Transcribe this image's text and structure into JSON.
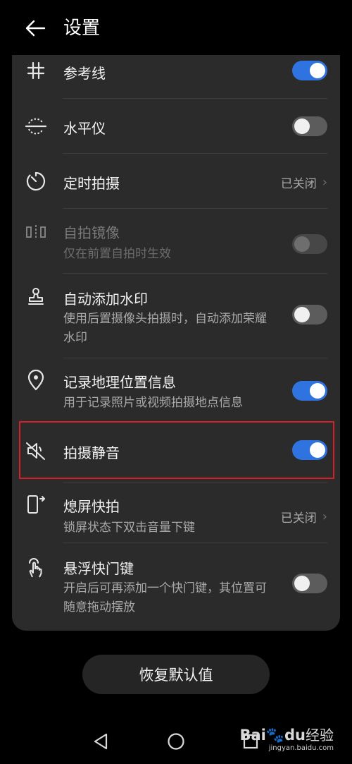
{
  "header": {
    "title": "设置",
    "back_icon": "arrow-left-icon"
  },
  "settings": {
    "grid": {
      "title": "参考线",
      "toggle": "on",
      "icon": "grid-icon"
    },
    "level": {
      "title": "水平仪",
      "toggle": "off",
      "icon": "level-icon"
    },
    "timer": {
      "title": "定时拍摄",
      "value": "已关闭",
      "icon": "timer-icon"
    },
    "mirror": {
      "title": "自拍镜像",
      "desc": "仅在前置自拍时生效",
      "toggle": "disabled-off",
      "icon": "mirror-icon"
    },
    "watermark": {
      "title": "自动添加水印",
      "desc": "使用后置摄像头拍摄时，自动添加荣耀水印",
      "toggle": "off",
      "icon": "stamp-icon"
    },
    "location": {
      "title": "记录地理位置信息",
      "desc": "用于记录照片或视频拍摄地点信息",
      "toggle": "on",
      "icon": "location-pin-icon"
    },
    "mute": {
      "title": "拍摄静音",
      "toggle": "on",
      "icon": "speaker-mute-icon",
      "highlighted": true
    },
    "screen_off": {
      "title": "熄屏快拍",
      "desc": "锁屏状态下双击音量下键",
      "value": "已关闭",
      "icon": "phone-screen-off-icon"
    },
    "floating_shutter": {
      "title": "悬浮快门键",
      "desc": "开启后可再添加一个快门键，其位置可随意拖动摆放",
      "toggle": "off",
      "icon": "hand-tap-icon"
    }
  },
  "restore_button": {
    "label": "恢复默认值"
  },
  "navbar": {
    "back_icon": "triangle-back-icon",
    "home_icon": "circle-home-icon",
    "recents_icon": "square-recents-icon"
  },
  "watermark_overlay": {
    "logo_text": "Bai",
    "logo_suffix": "du",
    "logo_cn": "经验",
    "url": "jingyan.baidu.com"
  },
  "colors": {
    "toggle_on": "#2f73e0",
    "highlight_border": "#d5202a",
    "panel_bg": "#2b2b2b"
  }
}
